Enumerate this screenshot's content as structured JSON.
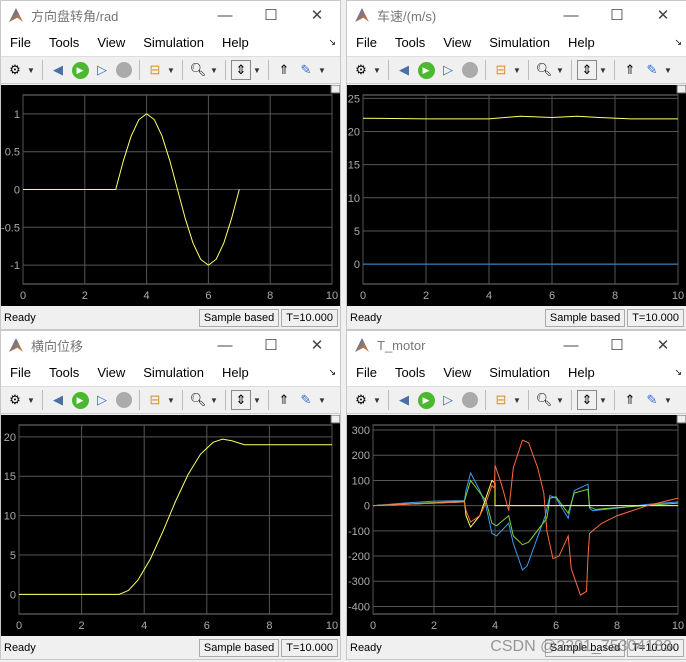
{
  "menus": [
    "File",
    "Tools",
    "View",
    "Simulation",
    "Help"
  ],
  "status": {
    "ready": "Ready",
    "mode": "Sample based",
    "time": "T=10.000"
  },
  "watermark": "CSDN @2201_75304183",
  "window_buttons": {
    "minimize": "—",
    "maximize": "☐",
    "close": "✕"
  },
  "scopes": [
    {
      "title": "方向盘转角/rad",
      "chart_data": {
        "type": "line",
        "xlim": [
          0,
          10
        ],
        "ylim": [
          -1.25,
          1.25
        ],
        "xticks": [
          0,
          2,
          4,
          6,
          8,
          10
        ],
        "yticks": [
          -1,
          -0.5,
          0,
          0.5,
          1
        ],
        "ytick_labels": [
          "-1",
          "-0.5",
          "0",
          "0.5",
          "1"
        ],
        "grid": true,
        "series": [
          {
            "color": "#ffff66",
            "points": [
              [
                0,
                0
              ],
              [
                3,
                0
              ],
              [
                3.25,
                0.383
              ],
              [
                3.5,
                0.707
              ],
              [
                3.75,
                0.924
              ],
              [
                4,
                1
              ],
              [
                4.25,
                0.924
              ],
              [
                4.5,
                0.707
              ],
              [
                4.75,
                0.383
              ],
              [
                5,
                0
              ],
              [
                5.25,
                -0.383
              ],
              [
                5.5,
                -0.707
              ],
              [
                5.75,
                -0.924
              ],
              [
                6,
                -1
              ],
              [
                6.25,
                -0.924
              ],
              [
                6.5,
                -0.707
              ],
              [
                6.75,
                -0.383
              ],
              [
                7,
                0
              ]
            ]
          }
        ]
      }
    },
    {
      "title": "车速/(m/s)",
      "chart_data": {
        "type": "line",
        "xlim": [
          0,
          10
        ],
        "ylim": [
          -3,
          25.5
        ],
        "xticks": [
          0,
          2,
          4,
          6,
          8,
          10
        ],
        "yticks": [
          0,
          5,
          10,
          15,
          20,
          25
        ],
        "ytick_labels": [
          "0",
          "5",
          "10",
          "15",
          "20",
          "25"
        ],
        "grid": true,
        "series": [
          {
            "color": "#ffff66",
            "points": [
              [
                0,
                22
              ],
              [
                2,
                21.9
              ],
              [
                4,
                21.9
              ],
              [
                4.5,
                22.1
              ],
              [
                5,
                22.3
              ],
              [
                6,
                22.1
              ],
              [
                6.8,
                22.3
              ],
              [
                7.5,
                22.1
              ],
              [
                8.5,
                21.9
              ],
              [
                10,
                21.9
              ]
            ]
          },
          {
            "color": "#3d8fe0",
            "points": [
              [
                0,
                0
              ],
              [
                10,
                0
              ]
            ]
          }
        ]
      }
    },
    {
      "title": "横向位移",
      "chart_data": {
        "type": "line",
        "xlim": [
          0,
          10
        ],
        "ylim": [
          -2.5,
          21.5
        ],
        "xticks": [
          0,
          2,
          4,
          6,
          8,
          10
        ],
        "yticks": [
          0,
          5,
          10,
          15,
          20
        ],
        "ytick_labels": [
          "0",
          "5",
          "10",
          "15",
          "20"
        ],
        "grid": true,
        "series": [
          {
            "color": "#ffff66",
            "points": [
              [
                0,
                0
              ],
              [
                3.2,
                0
              ],
              [
                3.5,
                0.5
              ],
              [
                3.8,
                1.8
              ],
              [
                4.2,
                4.5
              ],
              [
                4.6,
                8
              ],
              [
                5,
                11.8
              ],
              [
                5.4,
                15.2
              ],
              [
                5.8,
                17.8
              ],
              [
                6.2,
                19.3
              ],
              [
                6.5,
                19.7
              ],
              [
                6.8,
                19.5
              ],
              [
                7.2,
                19
              ],
              [
                8,
                19
              ],
              [
                10,
                19
              ]
            ]
          }
        ]
      }
    },
    {
      "title": "T_motor",
      "chart_data": {
        "type": "line",
        "xlim": [
          0,
          10
        ],
        "ylim": [
          -430,
          320
        ],
        "xticks": [
          0,
          2,
          4,
          6,
          8,
          10
        ],
        "yticks": [
          -400,
          -300,
          -200,
          -100,
          0,
          100,
          200,
          300
        ],
        "ytick_labels": [
          "-400",
          "-300",
          "-200",
          "-100",
          "0",
          "100",
          "200",
          "300"
        ],
        "grid": true,
        "series": [
          {
            "color": "#3d9bf0",
            "points": [
              [
                0,
                0
              ],
              [
                1,
                10
              ],
              [
                2,
                18
              ],
              [
                3,
                20
              ],
              [
                3.05,
                60
              ],
              [
                3.2,
                130
              ],
              [
                3.5,
                60
              ],
              [
                3.7,
                0
              ],
              [
                3.9,
                -110
              ],
              [
                4.05,
                -120
              ],
              [
                4.45,
                -70
              ],
              [
                4.6,
                -150
              ],
              [
                4.9,
                -255
              ],
              [
                5.05,
                -240
              ],
              [
                5.65,
                -40
              ],
              [
                5.8,
                40
              ],
              [
                6,
                30
              ],
              [
                6.4,
                -50
              ],
              [
                6.6,
                60
              ],
              [
                7.05,
                85
              ],
              [
                7.1,
                -10
              ],
              [
                7.2,
                -20
              ],
              [
                8,
                -10
              ],
              [
                9,
                5
              ],
              [
                10,
                15
              ]
            ]
          },
          {
            "color": "#7fd33a",
            "points": [
              [
                0,
                0
              ],
              [
                3,
                18
              ],
              [
                3.05,
                40
              ],
              [
                3.2,
                100
              ],
              [
                3.7,
                20
              ],
              [
                3.9,
                -70
              ],
              [
                4.05,
                -80
              ],
              [
                4.45,
                -40
              ],
              [
                4.6,
                -120
              ],
              [
                4.9,
                -155
              ],
              [
                5.1,
                -145
              ],
              [
                5.7,
                -50
              ],
              [
                5.8,
                30
              ],
              [
                6,
                35
              ],
              [
                6.4,
                -30
              ],
              [
                6.6,
                50
              ],
              [
                7.05,
                65
              ],
              [
                7.1,
                -5
              ],
              [
                7.3,
                -15
              ],
              [
                8,
                -8
              ],
              [
                10,
                10
              ]
            ]
          },
          {
            "color": "#ffff66",
            "points": [
              [
                0,
                0
              ],
              [
                3,
                15
              ],
              [
                3.05,
                -40
              ],
              [
                3.2,
                -85
              ],
              [
                3.5,
                -40
              ],
              [
                3.7,
                30
              ],
              [
                3.9,
                100
              ],
              [
                4,
                90
              ],
              [
                4,
                0
              ],
              [
                10,
                0
              ]
            ]
          },
          {
            "color": "#ff6a3d",
            "points": [
              [
                0,
                0
              ],
              [
                3,
                15
              ],
              [
                3.05,
                -20
              ],
              [
                3.2,
                -65
              ],
              [
                3.5,
                -40
              ],
              [
                3.7,
                10
              ],
              [
                3.9,
                80
              ],
              [
                3.98,
                70
              ],
              [
                4,
                160
              ],
              [
                4.2,
                90
              ],
              [
                4.45,
                -20
              ],
              [
                4.6,
                150
              ],
              [
                4.9,
                260
              ],
              [
                5.1,
                250
              ],
              [
                5.4,
                150
              ],
              [
                5.6,
                50
              ],
              [
                5.7,
                -100
              ],
              [
                5.9,
                -210
              ],
              [
                6.1,
                -200
              ],
              [
                6.4,
                -120
              ],
              [
                6.5,
                -250
              ],
              [
                6.8,
                -355
              ],
              [
                7,
                -340
              ],
              [
                7.05,
                -200
              ],
              [
                7.1,
                -110
              ],
              [
                7.5,
                -70
              ],
              [
                8,
                -40
              ],
              [
                9,
                0
              ],
              [
                10,
                30
              ]
            ]
          }
        ]
      }
    }
  ]
}
